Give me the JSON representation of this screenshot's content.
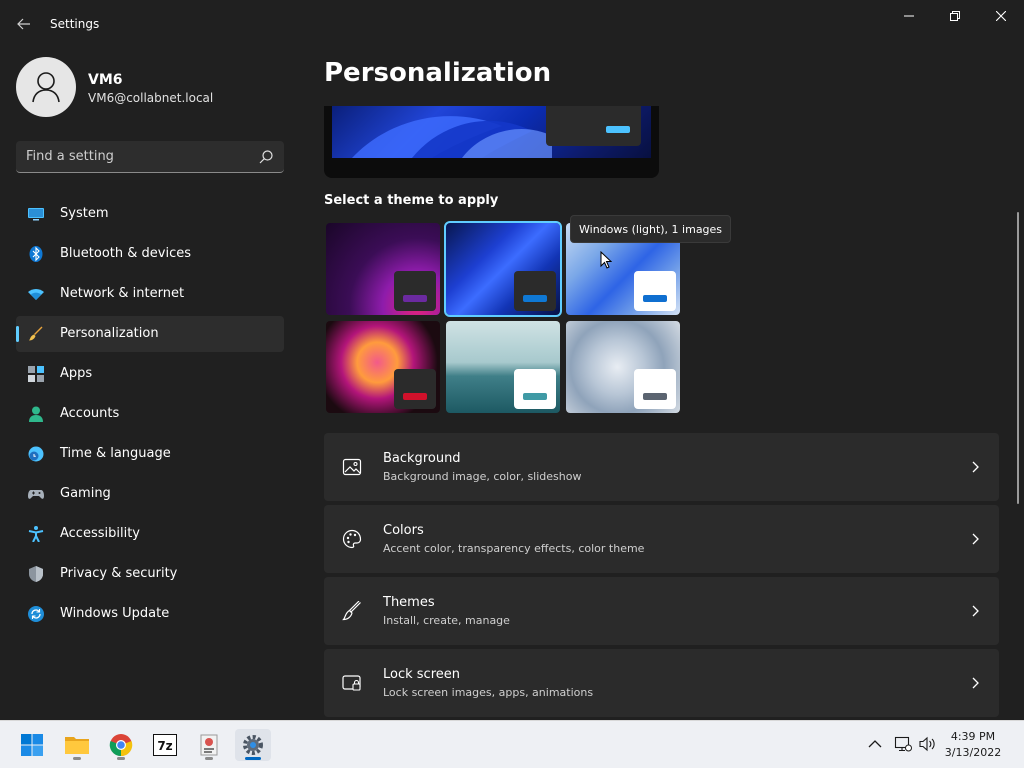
{
  "window": {
    "title": "Settings"
  },
  "profile": {
    "name": "VM6",
    "email": "VM6@collabnet.local"
  },
  "search": {
    "placeholder": "Find a setting"
  },
  "nav": {
    "items": [
      {
        "label": "System",
        "icon": "monitor-icon"
      },
      {
        "label": "Bluetooth & devices",
        "icon": "bluetooth-icon"
      },
      {
        "label": "Network & internet",
        "icon": "wifi-icon"
      },
      {
        "label": "Personalization",
        "icon": "brush-icon",
        "active": true
      },
      {
        "label": "Apps",
        "icon": "apps-icon"
      },
      {
        "label": "Accounts",
        "icon": "person-icon"
      },
      {
        "label": "Time & language",
        "icon": "clock-globe-icon"
      },
      {
        "label": "Gaming",
        "icon": "gamepad-icon"
      },
      {
        "label": "Accessibility",
        "icon": "accessibility-icon"
      },
      {
        "label": "Privacy & security",
        "icon": "shield-icon"
      },
      {
        "label": "Windows Update",
        "icon": "update-icon"
      }
    ]
  },
  "main": {
    "title": "Personalization",
    "themes_label": "Select a theme to apply",
    "tooltip": "Windows (light), 1 images",
    "themes": [
      {
        "accent": "#6b2aa0",
        "mini_bg": "#2b2b2b"
      },
      {
        "accent": "#0f78d4",
        "mini_bg": "#2b2b2b",
        "selected": true
      },
      {
        "accent": "#0f6fd0",
        "mini_bg": "#ffffff"
      },
      {
        "accent": "#d1112b",
        "mini_bg": "#2b2b2b"
      },
      {
        "accent": "#3f9aa5",
        "mini_bg": "#ffffff"
      },
      {
        "accent": "#5b6470",
        "mini_bg": "#ffffff"
      }
    ],
    "cards": [
      {
        "title": "Background",
        "desc": "Background image, color, slideshow",
        "icon": "image-icon"
      },
      {
        "title": "Colors",
        "desc": "Accent color, transparency effects, color theme",
        "icon": "palette-icon"
      },
      {
        "title": "Themes",
        "desc": "Install, create, manage",
        "icon": "brush-icon"
      },
      {
        "title": "Lock screen",
        "desc": "Lock screen images, apps, animations",
        "icon": "lock-screen-icon"
      }
    ]
  },
  "colors": {
    "accent": "#60cdff",
    "background": "#202020",
    "card": "#2b2b2b"
  },
  "taskbar": {
    "apps": [
      {
        "name": "start-icon"
      },
      {
        "name": "file-explorer-icon"
      },
      {
        "name": "chrome-icon"
      },
      {
        "name": "7zip-icon"
      },
      {
        "name": "installer-icon"
      },
      {
        "name": "settings-gear-icon",
        "active": true
      }
    ],
    "time": "4:39 PM",
    "date": "3/13/2022"
  }
}
